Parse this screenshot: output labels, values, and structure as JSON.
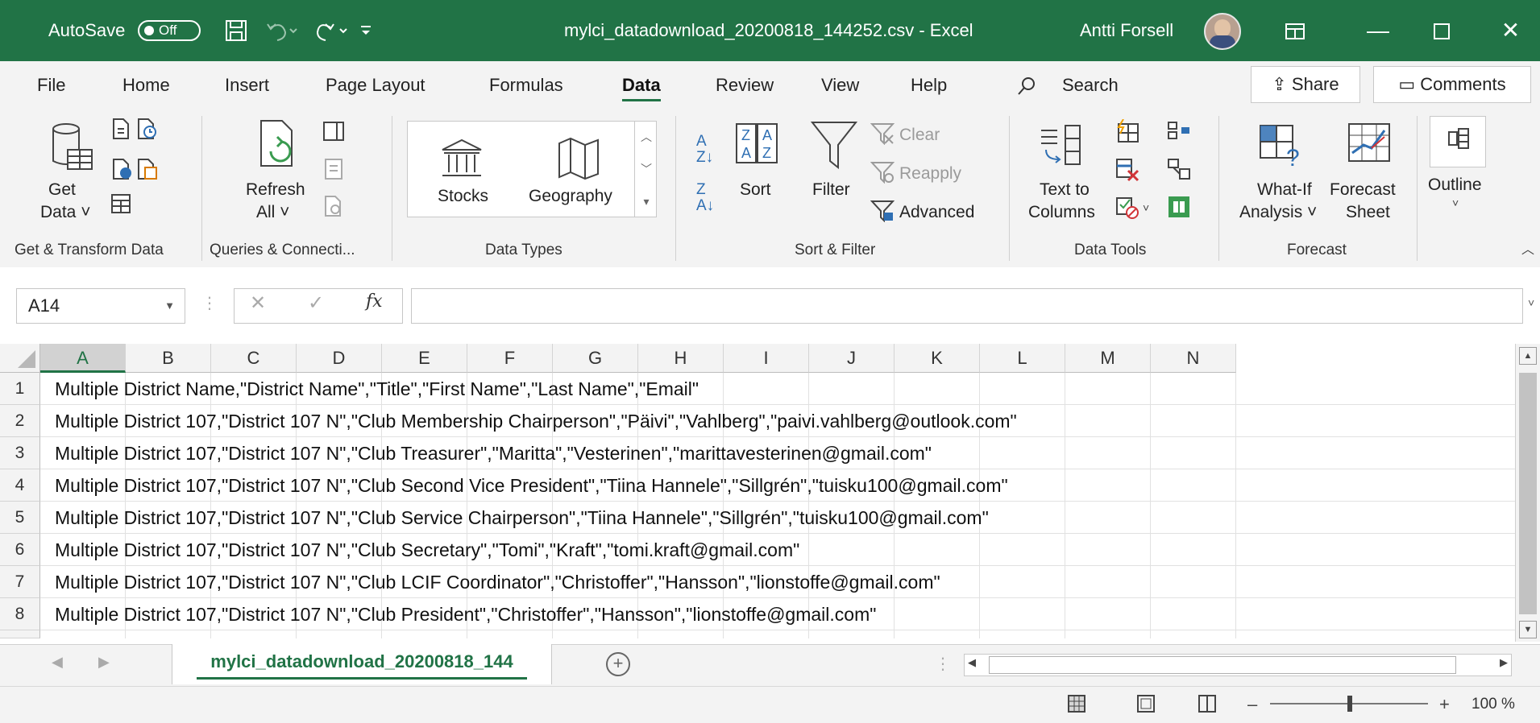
{
  "titlebar": {
    "autosave_label": "AutoSave",
    "autosave_state": "Off",
    "doc_title": "mylci_datadownload_20200818_144252.csv - Excel",
    "user_name": "Antti Forsell",
    "accent_color": "#217346"
  },
  "menu": {
    "items": [
      "File",
      "Home",
      "Insert",
      "Page Layout",
      "Formulas",
      "Data",
      "Review",
      "View",
      "Help"
    ],
    "active": "Data",
    "search_label": "Search",
    "share_label": "Share",
    "comments_label": "Comments"
  },
  "ribbon": {
    "get_data": "Get Data",
    "get_data_l1": "Get",
    "get_data_l2": "Data",
    "refresh_l1": "Refresh",
    "refresh_l2": "All",
    "stocks": "Stocks",
    "geography": "Geography",
    "sort": "Sort",
    "filter": "Filter",
    "clear": "Clear",
    "reapply": "Reapply",
    "advanced": "Advanced",
    "text_to_l1": "Text to",
    "text_to_l2": "Columns",
    "whatif_l1": "What-If",
    "whatif_l2": "Analysis",
    "forecast_l1": "Forecast",
    "forecast_l2": "Sheet",
    "outline": "Outline",
    "groups": {
      "get_transform": "Get & Transform Data",
      "queries": "Queries & Connecti...",
      "data_types": "Data Types",
      "sort_filter": "Sort & Filter",
      "data_tools": "Data Tools",
      "forecast": "Forecast"
    }
  },
  "formula_bar": {
    "name_box": "A14",
    "fx": "fx",
    "content": ""
  },
  "grid": {
    "columns": [
      "A",
      "B",
      "C",
      "D",
      "E",
      "F",
      "G",
      "H",
      "I",
      "J",
      "K",
      "L",
      "M",
      "N"
    ],
    "selected_column": "A",
    "rows": [
      {
        "num": "1",
        "text": "Multiple District Name,\"District Name\",\"Title\",\"First Name\",\"Last Name\",\"Email\""
      },
      {
        "num": "2",
        "text": "Multiple District 107,\"District 107 N\",\"Club Membership Chairperson\",\"Päivi\",\"Vahlberg\",\"paivi.vahlberg@outlook.com\""
      },
      {
        "num": "3",
        "text": "Multiple District 107,\"District 107 N\",\"Club Treasurer\",\"Maritta\",\"Vesterinen\",\"marittavesterinen@gmail.com\""
      },
      {
        "num": "4",
        "text": "Multiple District 107,\"District 107 N\",\"Club Second Vice President\",\"Tiina Hannele\",\"Sillgrén\",\"tuisku100@gmail.com\""
      },
      {
        "num": "5",
        "text": "Multiple District 107,\"District 107 N\",\"Club Service Chairperson\",\"Tiina Hannele\",\"Sillgrén\",\"tuisku100@gmail.com\""
      },
      {
        "num": "6",
        "text": "Multiple District 107,\"District 107 N\",\"Club Secretary\",\"Tomi\",\"Kraft\",\"tomi.kraft@gmail.com\""
      },
      {
        "num": "7",
        "text": "Multiple District 107,\"District 107 N\",\"Club LCIF Coordinator\",\"Christoffer\",\"Hansson\",\"lionstoffe@gmail.com\""
      },
      {
        "num": "8",
        "text": "Multiple District 107,\"District 107 N\",\"Club President\",\"Christoffer\",\"Hansson\",\"lionstoffe@gmail.com\""
      }
    ]
  },
  "sheets": {
    "active_tab": "mylci_datadownload_20200818_144"
  },
  "statusbar": {
    "zoom": "100 %"
  }
}
